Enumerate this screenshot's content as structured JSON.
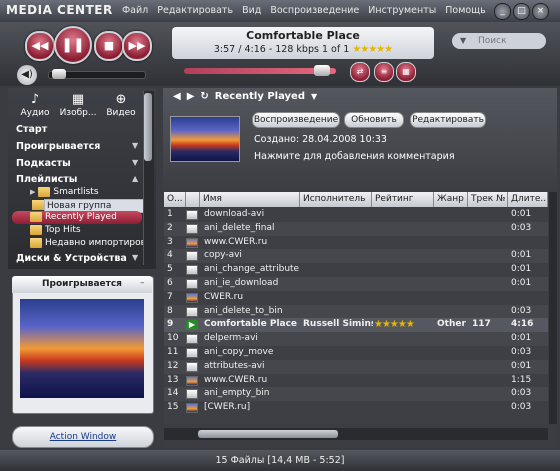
{
  "app": {
    "title": "MEDIA CENTER"
  },
  "menu": [
    "Файл",
    "Редактировать",
    "Вид",
    "Воспроизведение",
    "Инструменты",
    "Помощь"
  ],
  "window_buttons": [
    "_",
    "□",
    "×"
  ],
  "player": {
    "track_title": "Comfortable Place",
    "track_info": "3:57 / 4:16 - 128 kbps   1 of 1",
    "track_rating": "★★★★★",
    "buttons": {
      "prev": "◀◀",
      "play": "❚❚",
      "stop": "■",
      "next": "▶▶"
    },
    "volume_icon": "◀)",
    "mini": [
      "⇄",
      "≡",
      "▦"
    ]
  },
  "search": {
    "placeholder": "Поиск",
    "arrow": "▼"
  },
  "sidebar": {
    "categories": [
      {
        "label": "Аудио",
        "icon": "♪"
      },
      {
        "label": "Изобр...",
        "icon": "▦"
      },
      {
        "label": "Видео",
        "icon": "⊕"
      }
    ],
    "sections": [
      "Старт",
      "Проигрывается",
      "Подкасты",
      "Плейлисты"
    ],
    "tree": [
      "Smartlists",
      "Новая группа",
      "Recently Played",
      "Top Hits",
      "Недавно импортиров..."
    ],
    "devices": "Диски & Устройства"
  },
  "now_playing": {
    "header": "Проигрывается",
    "action_window": "Action Window"
  },
  "main": {
    "breadcrumb": "Recently Played",
    "buttons": [
      "Воспроизведение",
      "Обновить",
      "Редактировать"
    ],
    "created": "Создано: 28.04.2008 10:33",
    "comment": "Нажмите для добавления комментария"
  },
  "table": {
    "columns": [
      "О...",
      "",
      "Имя",
      "Исполнитель",
      "Рейтинг",
      "Жанр",
      "Трек №",
      "Длите..."
    ],
    "rows": [
      {
        "n": "1",
        "icon": "file",
        "name": "download-avi",
        "artist": "",
        "rating": "",
        "genre": "",
        "track": "",
        "dur": "0:01"
      },
      {
        "n": "2",
        "icon": "file",
        "name": "ani_delete_final",
        "artist": "",
        "rating": "",
        "genre": "",
        "track": "",
        "dur": "0:03"
      },
      {
        "n": "3",
        "icon": "img",
        "name": "www.CWER.ru",
        "artist": "",
        "rating": "",
        "genre": "",
        "track": "",
        "dur": ""
      },
      {
        "n": "4",
        "icon": "file",
        "name": "copy-avi",
        "artist": "",
        "rating": "",
        "genre": "",
        "track": "",
        "dur": "0:01"
      },
      {
        "n": "5",
        "icon": "file",
        "name": "ani_change_attributes",
        "artist": "",
        "rating": "",
        "genre": "",
        "track": "",
        "dur": "0:01"
      },
      {
        "n": "6",
        "icon": "file",
        "name": "ani_ie_download",
        "artist": "",
        "rating": "",
        "genre": "",
        "track": "",
        "dur": "0:01"
      },
      {
        "n": "7",
        "icon": "img",
        "name": "CWER.ru",
        "artist": "",
        "rating": "",
        "genre": "",
        "track": "",
        "dur": ""
      },
      {
        "n": "8",
        "icon": "file",
        "name": "ani_delete_to_bin",
        "artist": "",
        "rating": "",
        "genre": "",
        "track": "",
        "dur": "0:03"
      },
      {
        "n": "9",
        "icon": "play",
        "name": "Comfortable Place",
        "artist": "Russell Simins",
        "rating": "★★★★★",
        "genre": "Other",
        "track": "117",
        "dur": "4:16",
        "current": true
      },
      {
        "n": "10",
        "icon": "file",
        "name": "delperm-avi",
        "artist": "",
        "rating": "",
        "genre": "",
        "track": "",
        "dur": "0:01"
      },
      {
        "n": "11",
        "icon": "file",
        "name": "ani_copy_move",
        "artist": "",
        "rating": "",
        "genre": "",
        "track": "",
        "dur": "0:03"
      },
      {
        "n": "12",
        "icon": "file",
        "name": "attributes-avi",
        "artist": "",
        "rating": "",
        "genre": "",
        "track": "",
        "dur": "0:01"
      },
      {
        "n": "13",
        "icon": "img",
        "name": "www.CWER.ru",
        "artist": "",
        "rating": "",
        "genre": "",
        "track": "",
        "dur": "1:15"
      },
      {
        "n": "14",
        "icon": "file",
        "name": "ani_empty_bin",
        "artist": "",
        "rating": "",
        "genre": "",
        "track": "",
        "dur": "0:03"
      },
      {
        "n": "15",
        "icon": "img",
        "name": "[CWER.ru]",
        "artist": "",
        "rating": "",
        "genre": "",
        "track": "",
        "dur": "0:03"
      }
    ]
  },
  "status": "15 Файлы [14,4 MB - 5:52]"
}
